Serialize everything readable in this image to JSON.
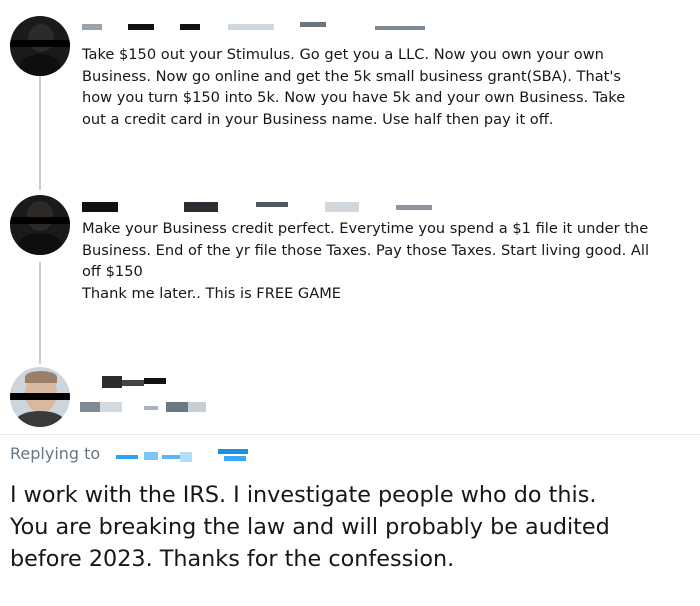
{
  "tweets": [
    {
      "text": "Take $150 out your Stimulus. Go get you a LLC. Now you own your own\nBusiness. Now go online and get the 5k small business grant(SBA). That's\nhow you turn $150 into 5k. Now you have 5k and your own Business. Take\nout a credit card in your Business name. Use half then pay it off."
    },
    {
      "text": "Make your Business credit perfect. Everytime you spend a $1 file it under the\nBusiness. End of the yr file those Taxes. Pay those Taxes. Start living good. All\noff $150\nThank me later.. This is FREE GAME"
    }
  ],
  "reply": {
    "replying_to_label": "Replying to",
    "text": "I work with the IRS. I investigate people who do this.\nYou are breaking the law and will probably be audited\nbefore 2023. Thanks for the confession."
  },
  "colors": {
    "text": "#14171a",
    "secondary": "#657786",
    "thread_line": "#c4cfd6",
    "redaction_blue": "#2aa5f5"
  }
}
